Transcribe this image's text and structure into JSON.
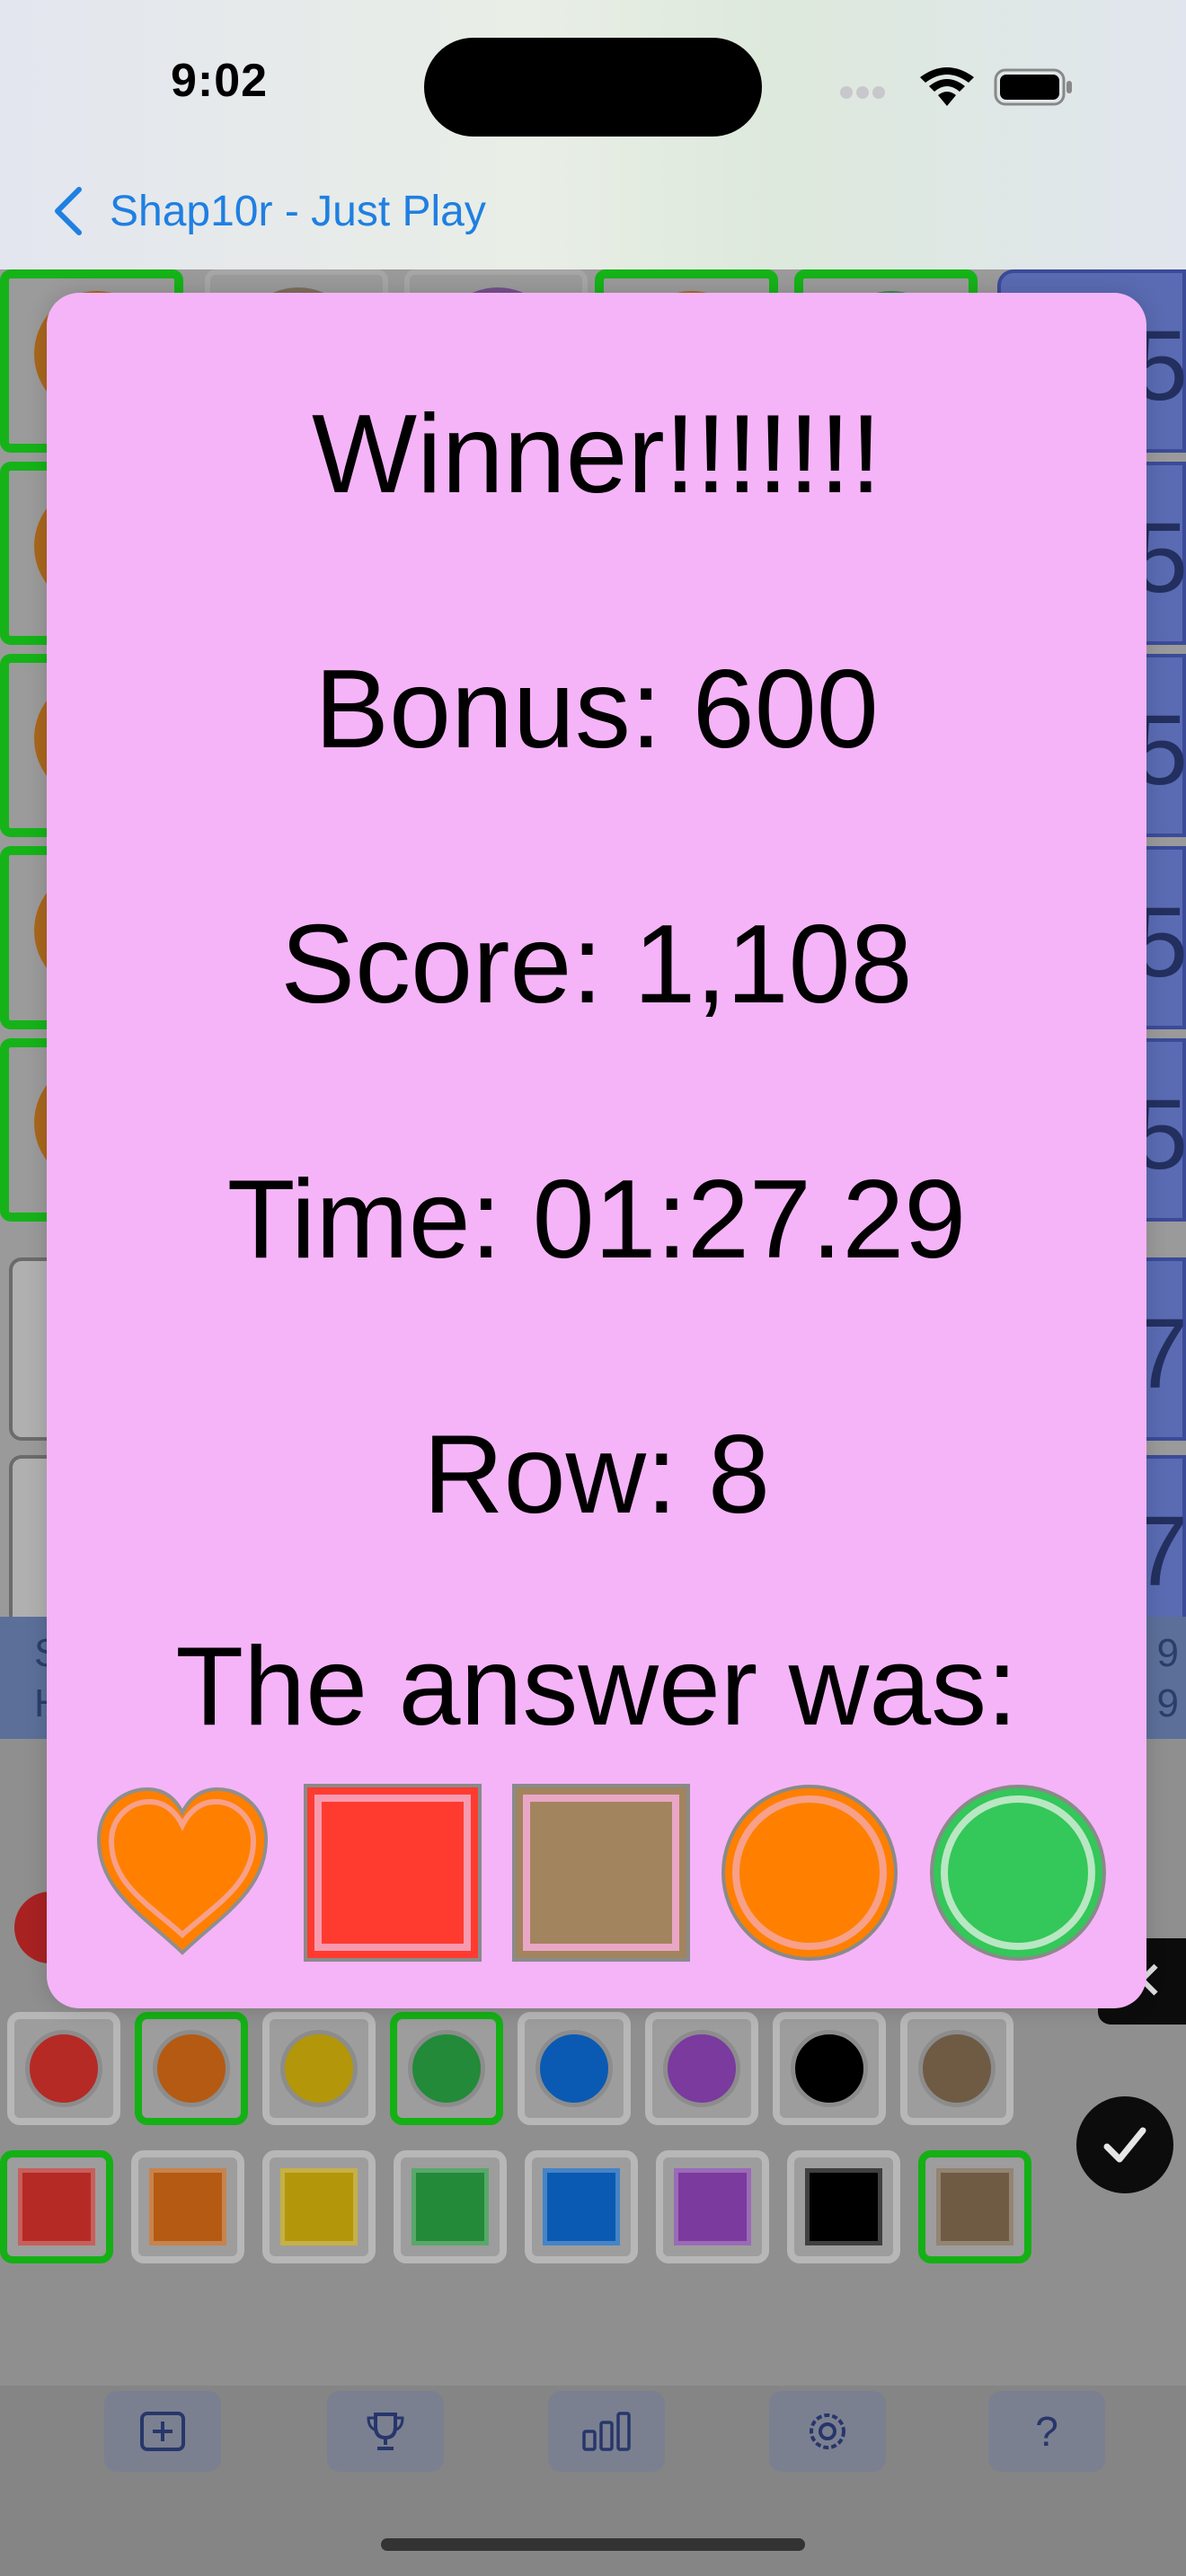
{
  "status_bar": {
    "time": "9:02"
  },
  "nav": {
    "back_label": "Shap10r - Just Play"
  },
  "stats_band": {
    "label_1": "S",
    "label_2": "H",
    "value_1": "9",
    "value_2": "9"
  },
  "modal": {
    "title": "Winner!!!!!!!",
    "bonus": "Bonus: 600",
    "score": "Score: 1,108",
    "time": "Time: 01:27.29",
    "row": "Row: 8",
    "answer_heading": "The answer was:",
    "answer": [
      {
        "shape": "heart",
        "color": "#ff7f00"
      },
      {
        "shape": "square",
        "color": "#ff3b30"
      },
      {
        "shape": "square",
        "color": "#a2845e"
      },
      {
        "shape": "circle",
        "color": "#ff7f00"
      },
      {
        "shape": "circle",
        "color": "#34c759"
      }
    ]
  },
  "picker": {
    "circle_colors": [
      "#b52a25",
      "#b55a12",
      "#b3960a",
      "#238a3a",
      "#0a5ab3",
      "#7a3a9e",
      "#000000",
      "#6f5b44"
    ],
    "square_colors": [
      "#b52a25",
      "#b55a12",
      "#b3960a",
      "#238a3a",
      "#0a5ab3",
      "#7a3a9e",
      "#000000",
      "#6f5b44"
    ]
  },
  "toolbar": {
    "icons": [
      "plus-square-icon",
      "trophy-icon",
      "bar-chart-icon",
      "gear-icon",
      "question-icon"
    ],
    "help_label": "?"
  },
  "feedback_digits": [
    "5",
    "5",
    "5",
    "5",
    "5",
    "7",
    "7"
  ]
}
